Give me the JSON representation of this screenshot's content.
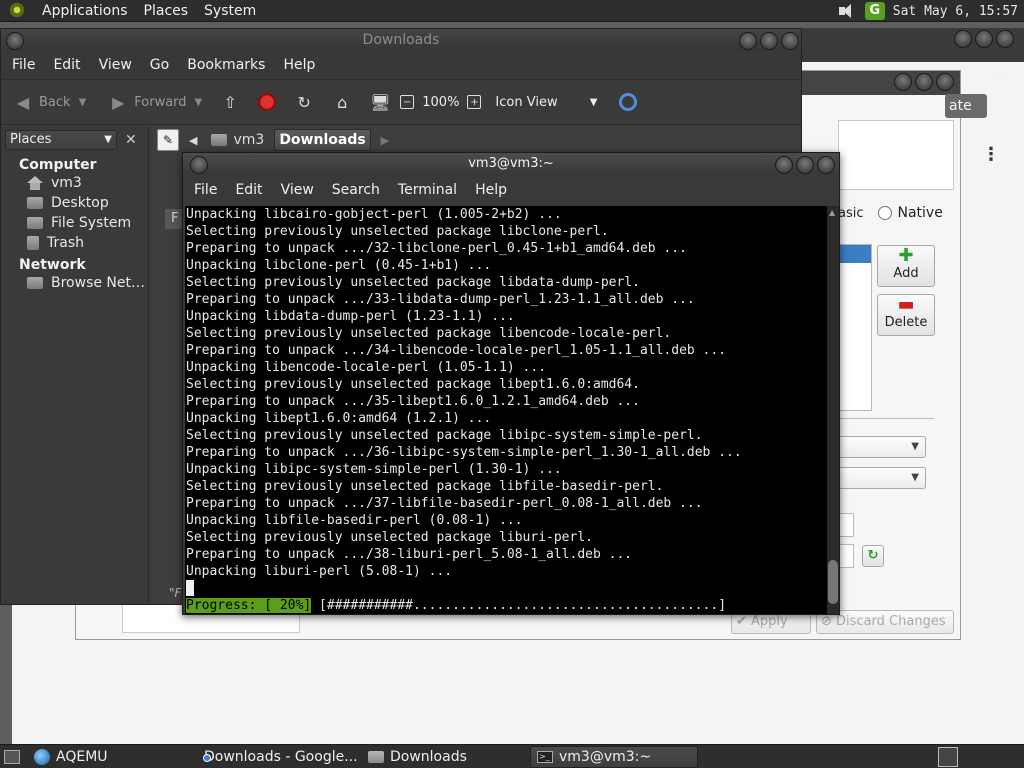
{
  "top_panel": {
    "menus": [
      "Applications",
      "Places",
      "System"
    ],
    "clock": "Sat May  6, 15:57",
    "indicator": "G"
  },
  "background_dialog": {
    "date_button_fragment": "ate",
    "radio_fragment": "asic",
    "radio_native": "Native",
    "add_button": "Add",
    "delete_button": "Delete",
    "apply_button": "Apply",
    "discard_button": "Discard Changes"
  },
  "file_manager": {
    "title": "Downloads",
    "menus": [
      "File",
      "Edit",
      "View",
      "Go",
      "Bookmarks",
      "Help"
    ],
    "toolbar": {
      "back": "Back",
      "forward": "Forward",
      "zoom": "100%",
      "view_mode": "Icon View"
    },
    "sidebar": {
      "selector": "Places",
      "computer_heading": "Computer",
      "computer_items": [
        "vm3",
        "Desktop",
        "File System",
        "Trash"
      ],
      "network_heading": "Network",
      "network_items": [
        "Browse Net…"
      ]
    },
    "path": [
      "vm3",
      "Downloads"
    ],
    "fragment": "F",
    "status_fragment": "\"F"
  },
  "terminal": {
    "title": "vm3@vm3:~",
    "menus": [
      "File",
      "Edit",
      "View",
      "Search",
      "Terminal",
      "Help"
    ],
    "lines": [
      "Unpacking libcairo-gobject-perl (1.005-2+b2) ...",
      "Selecting previously unselected package libclone-perl.",
      "Preparing to unpack .../32-libclone-perl_0.45-1+b1_amd64.deb ...",
      "Unpacking libclone-perl (0.45-1+b1) ...",
      "Selecting previously unselected package libdata-dump-perl.",
      "Preparing to unpack .../33-libdata-dump-perl_1.23-1.1_all.deb ...",
      "Unpacking libdata-dump-perl (1.23-1.1) ...",
      "Selecting previously unselected package libencode-locale-perl.",
      "Preparing to unpack .../34-libencode-locale-perl_1.05-1.1_all.deb ...",
      "Unpacking libencode-locale-perl (1.05-1.1) ...",
      "Selecting previously unselected package libept1.6.0:amd64.",
      "Preparing to unpack .../35-libept1.6.0_1.2.1_amd64.deb ...",
      "Unpacking libept1.6.0:amd64 (1.2.1) ...",
      "Selecting previously unselected package libipc-system-simple-perl.",
      "Preparing to unpack .../36-libipc-system-simple-perl_1.30-1_all.deb ...",
      "Unpacking libipc-system-simple-perl (1.30-1) ...",
      "Selecting previously unselected package libfile-basedir-perl.",
      "Preparing to unpack .../37-libfile-basedir-perl_0.08-1_all.deb ...",
      "Unpacking libfile-basedir-perl (0.08-1) ...",
      "Selecting previously unselected package liburi-perl.",
      "Preparing to unpack .../38-liburi-perl_5.08-1_all.deb ...",
      "Unpacking liburi-perl (5.08-1) ..."
    ],
    "progress_label": "Progress: [ 20%]",
    "progress_bar": " [###########.......................................]"
  },
  "taskbar": {
    "items": [
      "AQEMU",
      "Downloads - Google...",
      "Downloads",
      "vm3@vm3:~"
    ]
  },
  "colors": {
    "progress_green": "#5c9e1a",
    "selection_blue": "#3a7fc4"
  }
}
